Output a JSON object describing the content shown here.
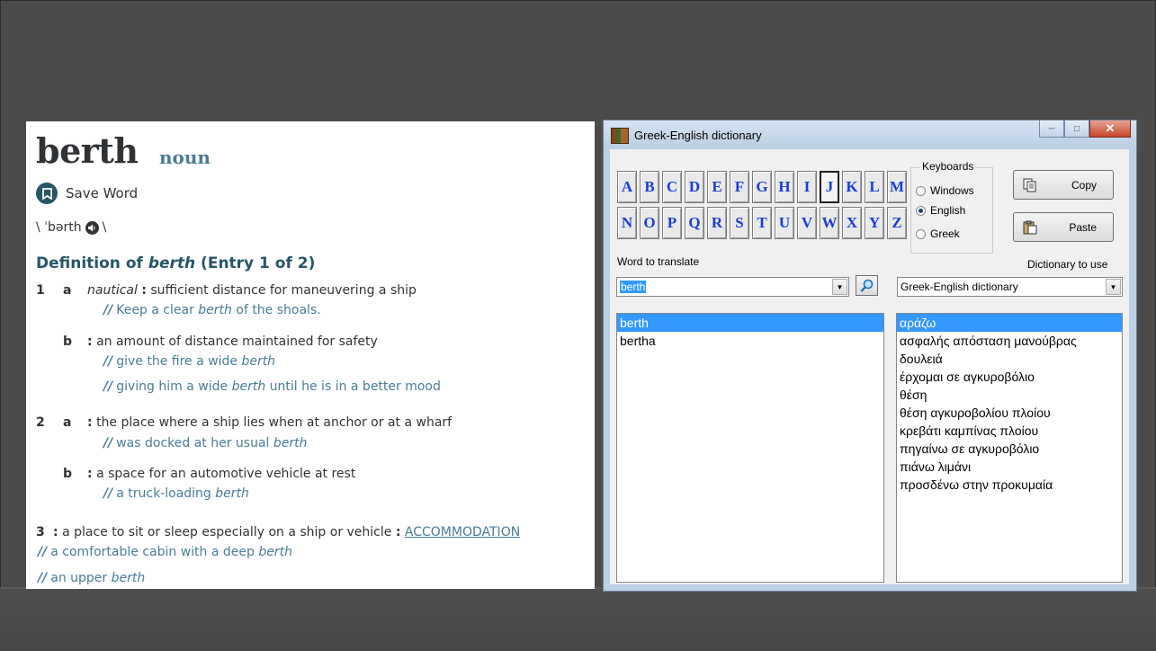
{
  "dictionary": {
    "headword": "berth",
    "part_of_speech": "noun",
    "save_label": "Save Word",
    "pron_open": "\\ ˈbərth",
    "pron_close": "\\",
    "heading_prefix": "Definition of ",
    "heading_word": "berth",
    "heading_suffix": " (Entry 1 of 2)",
    "sense1a_label": "nautical",
    "sense1a_def": "sufficient distance for maneuvering a ship",
    "sense1a_ex_pre": "Keep a clear ",
    "sense1a_ex_word": "berth",
    "sense1a_ex_post": " of the shoals.",
    "sense1b_def": "an amount of distance maintained for safety",
    "sense1b_ex1_pre": "give the fire a wide ",
    "sense1b_ex1_word": "berth",
    "sense1b_ex2_pre": "giving him a wide ",
    "sense1b_ex2_word": "berth",
    "sense1b_ex2_post": " until he is in a better mood",
    "sense2a_def": "the place where a ship lies when at anchor or at a wharf",
    "sense2a_ex_pre": "was docked at her usual ",
    "sense2a_ex_word": "berth",
    "sense2b_def": "a space for an automotive vehicle at rest",
    "sense2b_ex_pre": "a truck-loading ",
    "sense2b_ex_word": "berth",
    "sense3_def": "a place to sit or sleep especially on a ship or vehicle",
    "sense3_xref": "ACCOMMODATION",
    "sense3_ex1_pre": "a comfortable cabin with a deep ",
    "sense3_ex1_word": "berth",
    "sense3_ex2_pre": "an upper ",
    "sense3_ex2_word": "berth",
    "num1": "1",
    "num2": "2",
    "num3": "3",
    "let_a": "a",
    "let_b": "b",
    "colon": ":",
    "slashes": "//"
  },
  "window": {
    "title": "Greek-English dictionary",
    "letters_row1": [
      "A",
      "B",
      "C",
      "D",
      "E",
      "F",
      "G",
      "H",
      "I",
      "J",
      "K",
      "L",
      "M"
    ],
    "letters_row2": [
      "N",
      "O",
      "P",
      "Q",
      "R",
      "S",
      "T",
      "U",
      "V",
      "W",
      "X",
      "Y",
      "Z"
    ],
    "pressed_letter": "J",
    "keyboards_label": "Keyboards",
    "keyboard_options": [
      "Windows",
      "English",
      "Greek"
    ],
    "keyboard_selected": "English",
    "copy_label": "Copy",
    "paste_label": "Paste",
    "word_label": "Word to translate",
    "word_value": "berth",
    "dict_label": "Dictionary to use",
    "dict_value": "Greek-English dictionary",
    "word_list": [
      "berth",
      "bertha"
    ],
    "translations": [
      "αράζω",
      "ασφαλής απόσταση μανούβρας",
      "δουλειά",
      "έρχομαι σε αγκυροβόλιο",
      "θέση",
      "θέση αγκυροβολίου πλοίου",
      "κρεβάτι καμπίνας πλοίου",
      "πηγαίνω σε αγκυροβόλιο",
      "πιάνω λιμάνι",
      "προσδένω στην προκυμαία"
    ]
  },
  "colors": {
    "slide_bg": "#4b4b4b",
    "mw_dark_blue": "#265667",
    "mw_link_blue": "#4a7d95",
    "letter_blue": "#1a3ed4",
    "selection": "#3399ff"
  }
}
